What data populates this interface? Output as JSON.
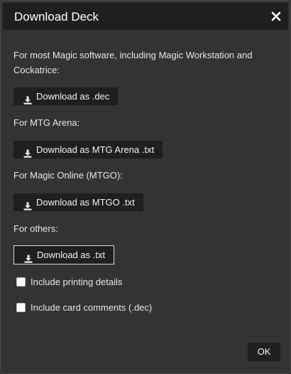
{
  "dialog": {
    "title": "Download Deck",
    "close_icon": "close-icon"
  },
  "sections": [
    {
      "label": "For most Magic software, including Magic Workstation and Cockatrice:",
      "button": "Download as .dec"
    },
    {
      "label": "For MTG Arena:",
      "button": "Download as MTG Arena .txt"
    },
    {
      "label": "For Magic Online (MTGO):",
      "button": "Download as MTGO .txt"
    },
    {
      "label": "For others:",
      "button": "Download as .txt"
    }
  ],
  "options": [
    {
      "label": "Include printing details",
      "checked": false
    },
    {
      "label": "Include card comments (.dec)",
      "checked": false
    }
  ],
  "footer": {
    "ok_label": "OK"
  },
  "icons": {
    "download": "download-icon",
    "checkbox": "checkbox-icon"
  }
}
